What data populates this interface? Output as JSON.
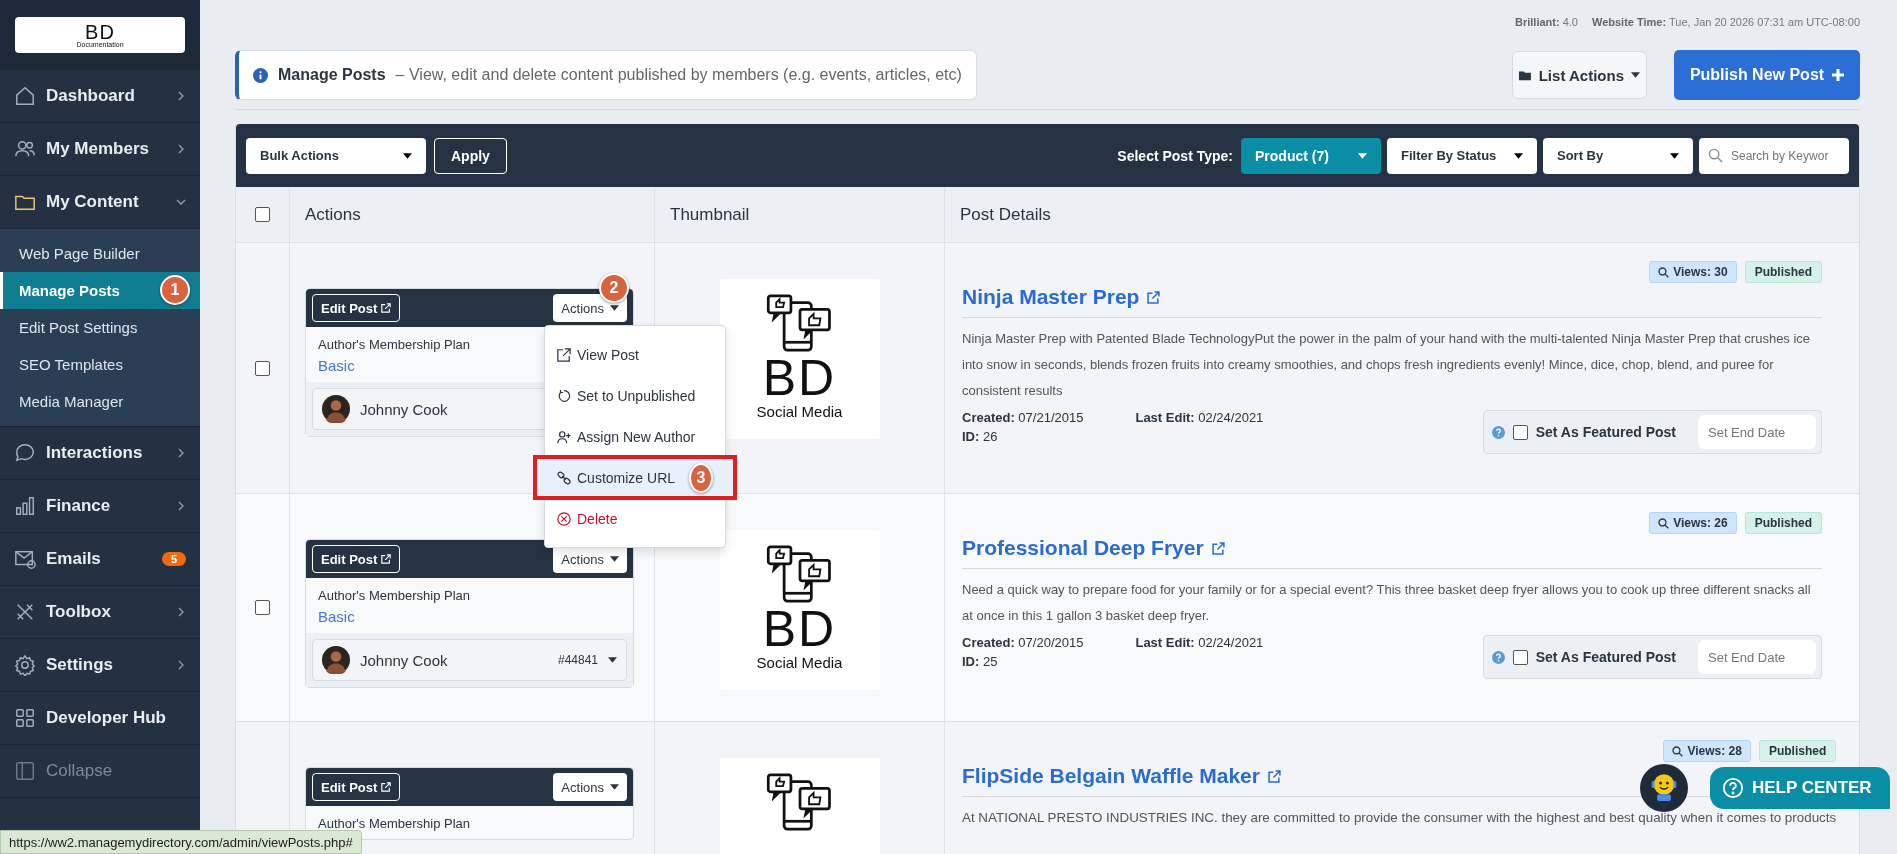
{
  "header": {
    "version_label": "Brilliant:",
    "version": "4.0",
    "time_label": "Website Time:",
    "time": "Tue, Jan 20 2026 07:31 am UTC-08:00"
  },
  "sidebar": {
    "logo": {
      "title": "BD",
      "subtitle": "Documentation"
    },
    "items": [
      {
        "label": "Dashboard",
        "expanded": false
      },
      {
        "label": "My Members",
        "expanded": false
      },
      {
        "label": "My Content",
        "expanded": true,
        "children": [
          {
            "label": "Web Page Builder",
            "selected": false
          },
          {
            "label": "Manage Posts",
            "selected": true,
            "step": "1"
          },
          {
            "label": "Edit Post Settings",
            "selected": false
          },
          {
            "label": "SEO Templates",
            "selected": false
          },
          {
            "label": "Media Manager",
            "selected": false
          }
        ]
      },
      {
        "label": "Interactions",
        "expanded": false
      },
      {
        "label": "Finance",
        "expanded": false
      },
      {
        "label": "Emails",
        "badge": "5"
      },
      {
        "label": "Toolbox",
        "expanded": false
      },
      {
        "label": "Settings",
        "expanded": false
      },
      {
        "label": "Developer Hub"
      },
      {
        "label": "Collapse",
        "disabled": true
      }
    ]
  },
  "intro": {
    "title": "Manage Posts",
    "description": "– View, edit and delete content published by members (e.g. events, articles, etc)"
  },
  "buttons": {
    "list_actions": "List Actions",
    "publish": "Publish New Post"
  },
  "toolbar": {
    "bulk_actions": "Bulk Actions",
    "apply": "Apply",
    "post_type_label": "Select Post Type:",
    "post_type": "Product (7)",
    "filter_status": "Filter By Status",
    "sort": "Sort By",
    "search_placeholder": "Search by Keywor"
  },
  "table": {
    "select_all_checked": false,
    "columns": [
      "Actions",
      "Thumbnail",
      "Post Details"
    ],
    "rows": [
      {
        "checked": false,
        "edit": "Edit Post",
        "actions": "Actions",
        "actions_step": "2",
        "plan_label": "Author's Membership Plan",
        "plan": "Basic",
        "author": "Johnny Cook",
        "thumbnail": {
          "title": "BD",
          "subtitle": "Social Media"
        },
        "views": "Views: 30",
        "status": "Published",
        "title": "Ninja Master Prep",
        "description": "Ninja Master Prep with Patented Blade TechnologyPut the power in the palm of your hand with the multi-talented Ninja Master Prep that crushes ice into snow in seconds, blends frozen fruits into creamy smoothies, and chops fresh ingredients evenly! Mince, dice, chop, blend, and puree for consistent results",
        "created_label": "Created:",
        "created": "07/21/2015",
        "last_edit_label": "Last Edit:",
        "last_edit": "02/24/2021",
        "id_label": "ID:",
        "id": "26",
        "featured": false,
        "featured_label": "Set As Featured Post",
        "end_date_placeholder": "Set End Date",
        "menu": [
          {
            "label": "View Post",
            "kind": "link",
            "highlighted": false
          },
          {
            "label": "Set to Unpublished",
            "kind": "refresh",
            "highlighted": false
          },
          {
            "label": "Assign New Author",
            "kind": "user",
            "highlighted": false
          },
          {
            "label": "Customize URL",
            "kind": "chain",
            "highlighted": true,
            "step": "3"
          },
          {
            "label": "Delete",
            "kind": "danger",
            "highlighted": false
          }
        ]
      },
      {
        "checked": false,
        "edit": "Edit Post",
        "actions": "Actions",
        "plan_label": "Author's Membership Plan",
        "plan": "Basic",
        "author": "Johnny Cook",
        "author_id": "#44841",
        "thumbnail": {
          "title": "BD",
          "subtitle": "Social Media"
        },
        "views": "Views: 26",
        "status": "Published",
        "title": "Professional Deep Fryer",
        "description": "Need a quick way to prepare food for your family or for a special event? This three basket deep fryer allows you to cook up three different snacks all at once in this 1 gallon 3 basket deep fryer.",
        "created_label": "Created:",
        "created": "07/20/2015",
        "last_edit_label": "Last Edit:",
        "last_edit": "02/24/2021",
        "id_label": "ID:",
        "id": "25",
        "featured": false,
        "featured_label": "Set As Featured Post",
        "end_date_placeholder": "Set End Date"
      },
      {
        "edit": "Edit Post",
        "actions": "Actions",
        "plan_label": "Author's Membership Plan",
        "thumbnail": {},
        "views": "Views: 28",
        "status": "Published",
        "title": "FlipSide Belgain Waffle Maker",
        "description": "At NATIONAL PRESTO INDUSTRIES INC. they are committed to provide the consumer with the highest and best quality when it comes to products"
      }
    ]
  },
  "help": {
    "label": "HELP CENTER"
  },
  "status_bar": "https://ww2.managemydirectory.com/admin/viewPosts.php#"
}
